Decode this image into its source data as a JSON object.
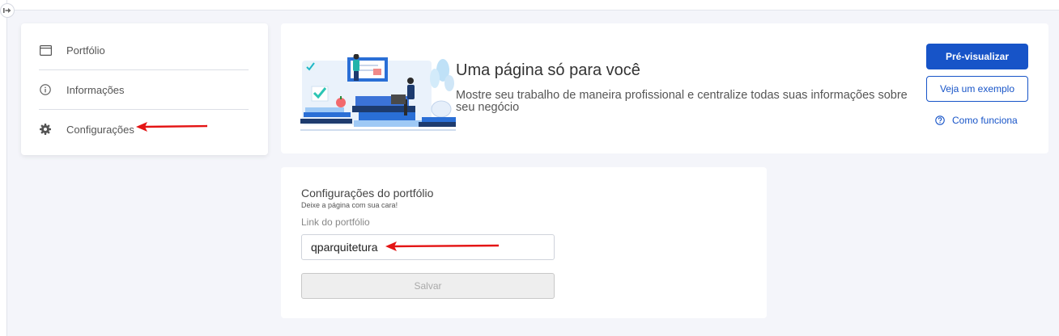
{
  "sidebar": {
    "items": [
      {
        "label": "Portfólio",
        "icon": "window-icon"
      },
      {
        "label": "Informações",
        "icon": "info-circle-icon"
      },
      {
        "label": "Configurações",
        "icon": "gear-icon"
      }
    ]
  },
  "hero": {
    "title": "Uma página só para você",
    "description": "Mostre seu trabalho de maneira profissional e centralize todas suas informações sobre seu negócio",
    "preview_button": "Pré-visualizar",
    "example_button": "Veja um exemplo",
    "how_link": "Como funciona"
  },
  "config": {
    "title": "Configurações do portfólio",
    "subtitle": "Deixe a página com sua cara!",
    "link_label": "Link do portfólio",
    "link_value": "qparquitetura",
    "save_button": "Salvar"
  },
  "colors": {
    "accent": "#1754c8",
    "annotation": "#e41414",
    "background": "#f4f5fa"
  }
}
